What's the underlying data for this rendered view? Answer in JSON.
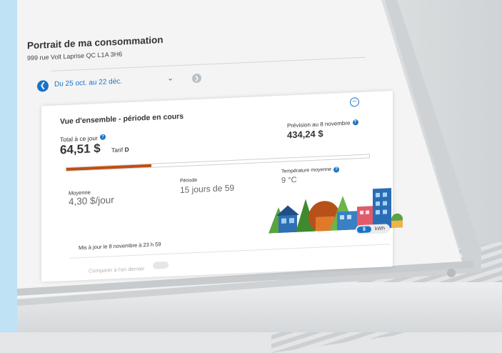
{
  "page": {
    "title": "Portrait de ma consommation",
    "address": "999 rue Volt Laprise QC L1A 3H6"
  },
  "period": {
    "label": "Du 25 oct. au 22 déc."
  },
  "card": {
    "title": "Vue d'ensemble - période en cours",
    "total_label": "Total à ce jour",
    "total_value": "64,51 $",
    "tarif_label": "Tarif",
    "tarif_code": "D",
    "forecast_label": "Prévision au 8 novembre",
    "forecast_value": "434,24 $",
    "progress_fraction": 0.28,
    "average_label": "Moyenne",
    "average_value": "4,30 $/jour",
    "period_label": "Période",
    "period_value": "15 jours de 59",
    "temp_label": "Température moyenne",
    "temp_value": "9 °C",
    "updated": "Mis à jour le 8 novembre à 23 h 59",
    "unit_toggle": {
      "active": "$",
      "inactive": "kWh"
    },
    "compare_label": "Comparer à l'an dernier"
  },
  "colors": {
    "accent": "#1b74c5",
    "progress": "#c34c10",
    "side_band": "#bfe2f5"
  },
  "icons": [
    "chevron-left-icon",
    "chevron-down-icon",
    "chevron-right-icon",
    "help-icon",
    "minus-circle-icon",
    "town-illustration"
  ]
}
